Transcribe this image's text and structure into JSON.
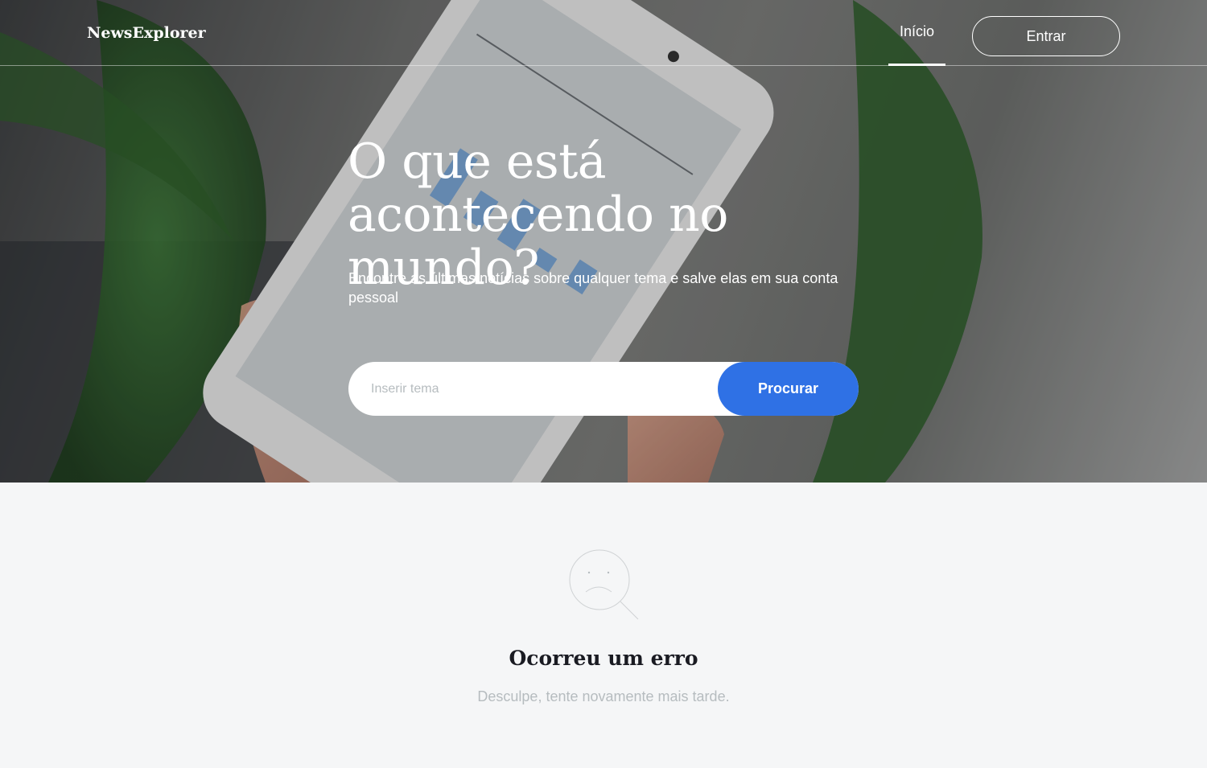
{
  "header": {
    "logo": "NewsExplorer",
    "nav_home_label": "Início",
    "signin_label": "Entrar"
  },
  "hero": {
    "title": "O que está acontecendo no mundo?",
    "subtitle": "Encontre as últimas notícias sobre qualquer tema e salve elas em sua conta pessoal",
    "search": {
      "placeholder": "Inserir tema",
      "value": "",
      "button_label": "Procurar"
    }
  },
  "result": {
    "icon": "sad-face-search-icon",
    "title": "Ocorreu um erro",
    "text": "Desculpe, tente novamente mais tarde."
  },
  "colors": {
    "accent": "#2f71e5",
    "page_background": "#f5f6f7",
    "muted_text": "#b6bcbf",
    "dark_text": "#1a1b22"
  }
}
